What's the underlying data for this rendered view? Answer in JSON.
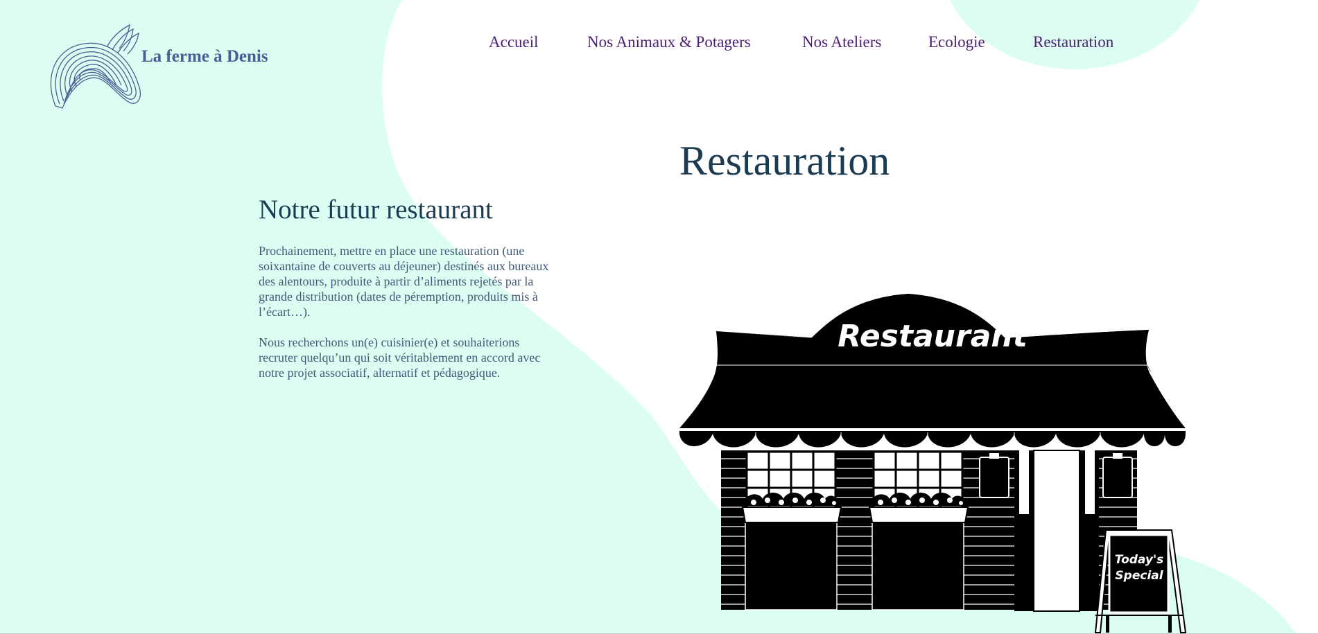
{
  "brand": {
    "name": "La ferme à Denis",
    "logo_icon": "horse-head-line-art-logo"
  },
  "nav": {
    "items": [
      {
        "label": "Accueil"
      },
      {
        "label": "Nos Animaux & Potagers"
      },
      {
        "label": "Nos Ateliers"
      },
      {
        "label": "Ecologie"
      },
      {
        "label": "Restauration"
      }
    ]
  },
  "main": {
    "title": "Restauration",
    "section_title": "Notre futur restaurant",
    "paragraph_1": "Prochainement, mettre en place une restauration (une soixantaine de couverts au déjeuner) destinés aux bureaux des alentours, produite à partir d’aliments rejetés par la grande distribution (dates de péremption, produits mis à l’écart…).",
    "paragraph_2": "Nous recherchons un(e) cuisinier(e) et souhaiterions recruter quelqu’un qui soit véritablement en accord avec notre projet associatif, alternatif et pédagogique."
  },
  "illustration": {
    "sign_text": "Restaurant",
    "board_line_1": "Today's",
    "board_line_2": "Special",
    "icon": "restaurant-storefront-illustration"
  },
  "colors": {
    "mint_background": "#dcfdf1",
    "white_shape": "#ffffff",
    "nav_text": "#4b1f74",
    "title_text": "#1b3b52",
    "body_text": "#3f5a7a",
    "brand_text": "#4a5f95"
  }
}
